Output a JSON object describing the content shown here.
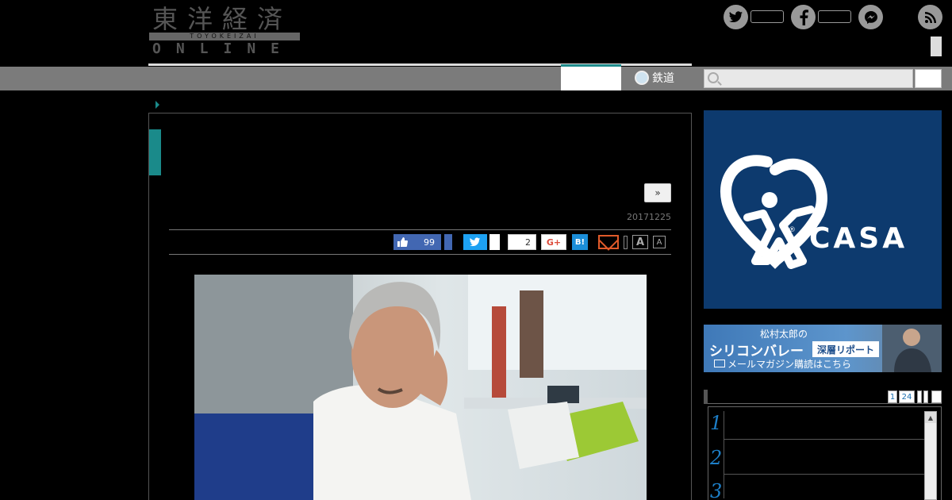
{
  "brand": {
    "kanji": "東洋経済",
    "roman": "TOYOKEIZAI",
    "online": "ONLINE"
  },
  "social_icons": [
    "twitter-icon",
    "facebook-icon",
    "messenger-icon",
    "rss-icon"
  ],
  "nav": {
    "railway_label": "鉄道",
    "search_placeholder": ""
  },
  "article": {
    "next_label": "»",
    "date": "20171225",
    "share": {
      "like_count": "99",
      "gplus_count": "2",
      "gplus_label": "G+",
      "hatena_label": "B!",
      "font_large": "A",
      "font_small": "A"
    }
  },
  "sidebar": {
    "ad_casa": {
      "brand": "CASA",
      "reg": "®"
    },
    "ad_mailmag": {
      "line1": "松村太郎の",
      "line2": "シリコンバレー",
      "badge": "深層リポート",
      "line3": "メールマガジン購読はこちら"
    },
    "ranking": {
      "tabs": [
        "1",
        "24"
      ],
      "items": [
        "1",
        "2",
        "3"
      ],
      "scroll_up": "▲"
    }
  },
  "colors": {
    "accent_teal": "#1a8a8a",
    "nav_gray": "#7b7b7b",
    "casa_blue": "#0d3a6e",
    "rank_blue": "#1d7fc8"
  }
}
